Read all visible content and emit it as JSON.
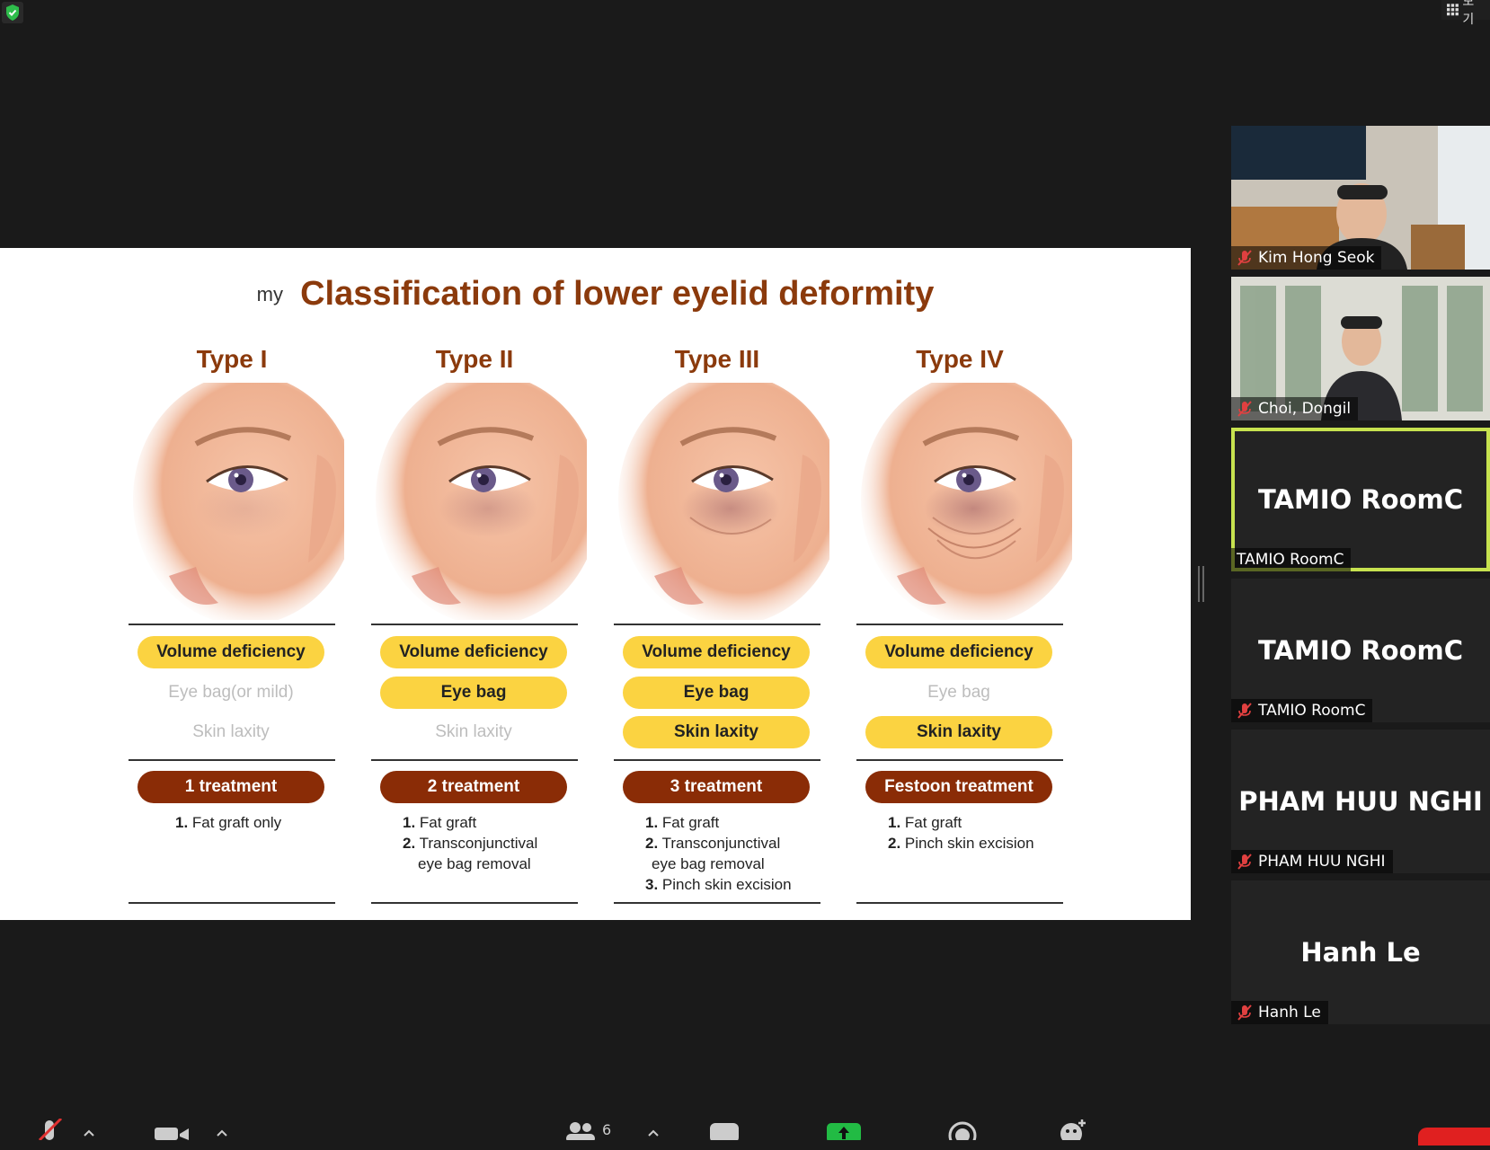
{
  "topbar": {
    "view_label": "보기",
    "shield_color": "#2ebd4b"
  },
  "slide": {
    "title_prefix": "my",
    "title": "Classification of lower eyelid deformity",
    "columns": [
      {
        "type": "Type I",
        "volume": "Volume deficiency",
        "eyebag": "Eye bag(or mild)",
        "skin": "Skin laxity",
        "treatment": "1 treatment",
        "items": [
          [
            "1.",
            "Fat graft only"
          ]
        ],
        "highlight": [
          true,
          false,
          false
        ],
        "severity": 0
      },
      {
        "type": "Type II",
        "volume": "Volume deficiency",
        "eyebag": "Eye bag",
        "skin": "Skin laxity",
        "treatment": "2 treatment",
        "items": [
          [
            "1.",
            "Fat graft"
          ],
          [
            "2.",
            "Transconjunctival"
          ],
          [
            "",
            "eye bag removal"
          ]
        ],
        "highlight": [
          true,
          true,
          false
        ],
        "severity": 1
      },
      {
        "type": "Type III",
        "volume": "Volume deficiency",
        "eyebag": "Eye bag",
        "skin": "Skin laxity",
        "treatment": "3 treatment",
        "items": [
          [
            "1.",
            "Fat graft"
          ],
          [
            "2.",
            "Transconjunctival"
          ],
          [
            "",
            "eye bag removal"
          ],
          [
            "3.",
            "Pinch skin excision"
          ]
        ],
        "highlight": [
          true,
          true,
          true
        ],
        "severity": 2
      },
      {
        "type": "Type IV",
        "volume": "Volume deficiency",
        "eyebag": "Eye bag",
        "skin": "Skin laxity",
        "treatment": "Festoon treatment",
        "items": [
          [
            "1.",
            "Fat graft"
          ],
          [
            "2.",
            "Pinch skin excision"
          ]
        ],
        "highlight": [
          true,
          false,
          true
        ],
        "severity": 3
      }
    ]
  },
  "participants": [
    {
      "name": "Kim Hong Seok",
      "video": true,
      "muted": true
    },
    {
      "name": "Choi, Dongil",
      "video": true,
      "muted": true
    },
    {
      "name": "TAMIO RoomC",
      "display": "TAMIO RoomC",
      "video": false,
      "muted": false,
      "active": true
    },
    {
      "name": "TAMIO RoomC",
      "display": "TAMIO RoomC",
      "video": false,
      "muted": true
    },
    {
      "name": "PHAM HUU NGHI",
      "display": "PHAM HUU NGHI",
      "video": false,
      "muted": true
    },
    {
      "name": "Hanh Le",
      "display": "Hanh Le",
      "video": false,
      "muted": true
    }
  ],
  "toolbar": {
    "participants_count": "6",
    "share_color": "#22bb44",
    "end_color": "#e02020"
  }
}
